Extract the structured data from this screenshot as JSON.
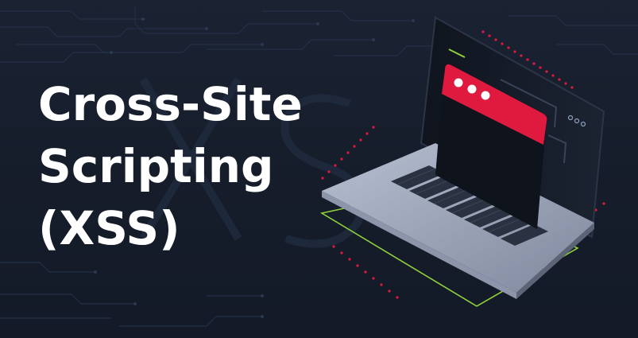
{
  "headline": {
    "line1": "Cross-Site",
    "line2": "Scripting",
    "line3": "(XSS)"
  },
  "colors": {
    "background": "#161d2b",
    "title": "#ffffff",
    "accent_red": "#e0193f",
    "accent_green": "#8fd13b",
    "laptop_body": "#9aa3b8",
    "screen": "#111722"
  },
  "icons": [
    "circuit-pattern",
    "laptop-icon",
    "browser-window-icon"
  ]
}
